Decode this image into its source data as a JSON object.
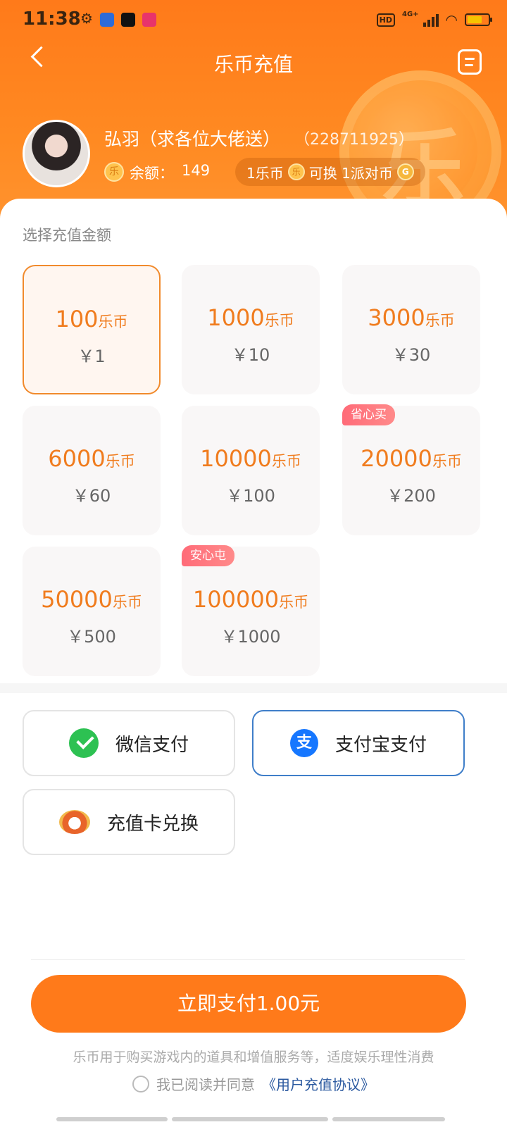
{
  "status_bar": {
    "time": "11:38",
    "hd": "HD",
    "network": "4G+"
  },
  "nav": {
    "title": "乐币充值"
  },
  "user": {
    "name": "弘羽（求各位大佬送）",
    "id": "（228711925）",
    "balance_label": "余额：",
    "balance_value": "149",
    "coin_glyph": "乐",
    "exchange": {
      "left": "1乐币",
      "middle": "可换 1派对币",
      "party_glyph": "G"
    }
  },
  "recharge": {
    "section_label": "选择充值金额",
    "packages": [
      {
        "coins": "100",
        "unit": "乐币",
        "price": "￥1",
        "tag": "",
        "selected": true
      },
      {
        "coins": "1000",
        "unit": "乐币",
        "price": "￥10",
        "tag": "",
        "selected": false
      },
      {
        "coins": "3000",
        "unit": "乐币",
        "price": "￥30",
        "tag": "",
        "selected": false
      },
      {
        "coins": "6000",
        "unit": "乐币",
        "price": "￥60",
        "tag": "",
        "selected": false
      },
      {
        "coins": "10000",
        "unit": "乐币",
        "price": "￥100",
        "tag": "",
        "selected": false
      },
      {
        "coins": "20000",
        "unit": "乐币",
        "price": "￥200",
        "tag": "省心买",
        "selected": false
      },
      {
        "coins": "50000",
        "unit": "乐币",
        "price": "￥500",
        "tag": "",
        "selected": false
      },
      {
        "coins": "100000",
        "unit": "乐币",
        "price": "￥1000",
        "tag": "安心屯",
        "selected": false
      }
    ]
  },
  "payment": {
    "methods": [
      {
        "label": "微信支付",
        "icon": "wechat-pay-icon",
        "active": false
      },
      {
        "label": "支付宝支付",
        "icon": "alipay-icon",
        "active": true
      },
      {
        "label": "充值卡兑换",
        "icon": "recharge-card-icon",
        "active": false
      }
    ],
    "alipay_glyph": "支"
  },
  "footer": {
    "pay_button": "立即支付1.00元",
    "notice": "乐币用于购买游戏内的道具和增值服务等，适度娱乐理性消费",
    "agree_text": "我已阅读并同意",
    "agreement_link": "《用户充值协议》"
  },
  "colors": {
    "brand_orange": "#ff7a1a",
    "price_orange": "#f07c1e",
    "tag_pink": "#ff6b78",
    "alipay_blue": "#1677ff",
    "wechat_green": "#2dc152"
  }
}
